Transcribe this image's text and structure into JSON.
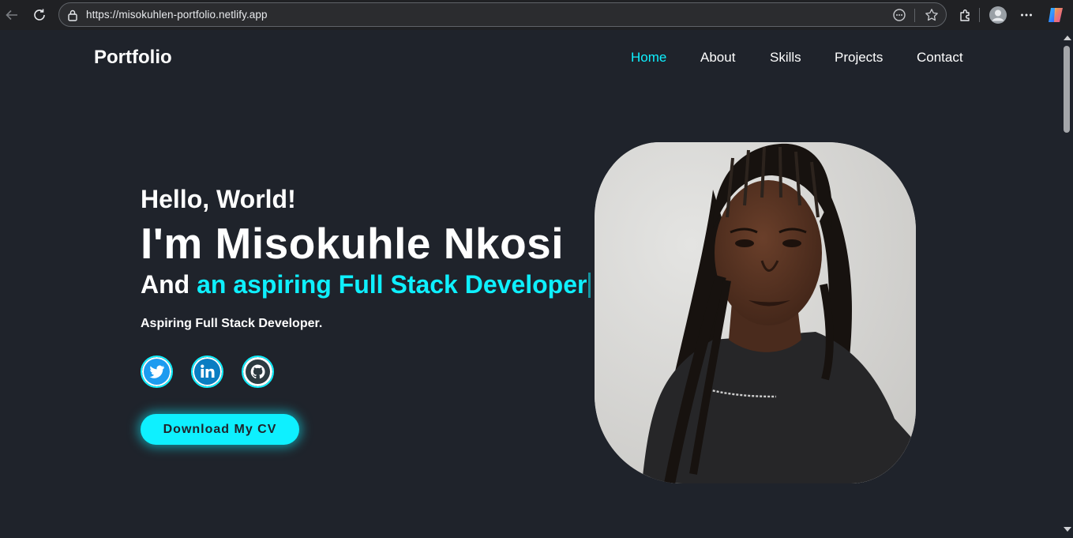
{
  "browser": {
    "url": "https://misokuhlen-portfolio.netlify.app",
    "icons": [
      "back-icon",
      "reload-icon",
      "lock-icon",
      "reader-icon",
      "star-icon",
      "extensions-icon",
      "profile-icon",
      "more-icon",
      "copilot-icon"
    ]
  },
  "site": {
    "brand": "Portfolio",
    "nav": [
      {
        "label": "Home",
        "active": true
      },
      {
        "label": "About",
        "active": false
      },
      {
        "label": "Skills",
        "active": false
      },
      {
        "label": "Projects",
        "active": false
      },
      {
        "label": "Contact",
        "active": false
      }
    ]
  },
  "hero": {
    "greeting": "Hello, World!",
    "name": "I'm Misokuhle Nkosi",
    "role_prefix": "And",
    "role_typed": "an aspiring Full Stack Developer",
    "tagline": "Aspiring Full Stack Developer.",
    "social": [
      "twitter-icon",
      "linkedin-icon",
      "github-icon"
    ],
    "cv_button": "Download My CV"
  },
  "colors": {
    "background": "#1f232b",
    "accent": "#0ef0ff",
    "text": "#ffffff"
  }
}
